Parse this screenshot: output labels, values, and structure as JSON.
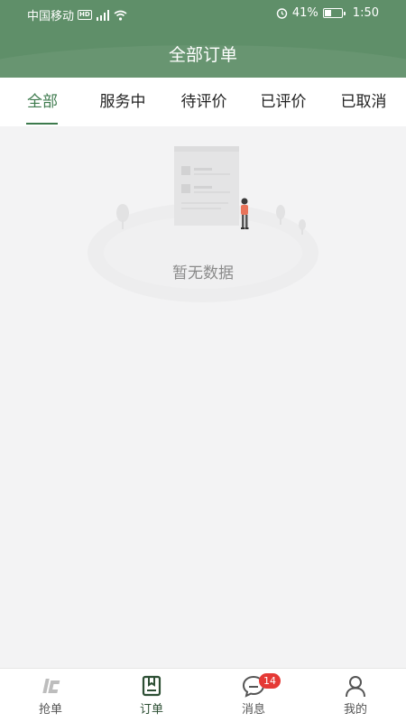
{
  "status_bar": {
    "carrier": "中国移动",
    "hd": "HD",
    "network": "4G",
    "battery": "41%",
    "battery_level": 0.41,
    "time": "1:50"
  },
  "header": {
    "title": "全部订单",
    "bg_color": "#5f8f69"
  },
  "tabs": [
    {
      "label": "全部",
      "active": true
    },
    {
      "label": "服务中",
      "active": false
    },
    {
      "label": "待评价",
      "active": false
    },
    {
      "label": "已评价",
      "active": false
    },
    {
      "label": "已取消",
      "active": false
    }
  ],
  "empty_state": {
    "text": "暂无数据"
  },
  "bottom_nav": {
    "items": [
      {
        "label": "抢单",
        "icon": "grab-order-icon"
      },
      {
        "label": "订单",
        "icon": "order-book-icon",
        "active": true
      },
      {
        "label": "消息",
        "icon": "message-bubble-icon",
        "badge": "14"
      },
      {
        "label": "我的",
        "icon": "person-icon"
      }
    ]
  },
  "colors": {
    "accent": "#3d7a4d",
    "badge": "#e53935"
  }
}
